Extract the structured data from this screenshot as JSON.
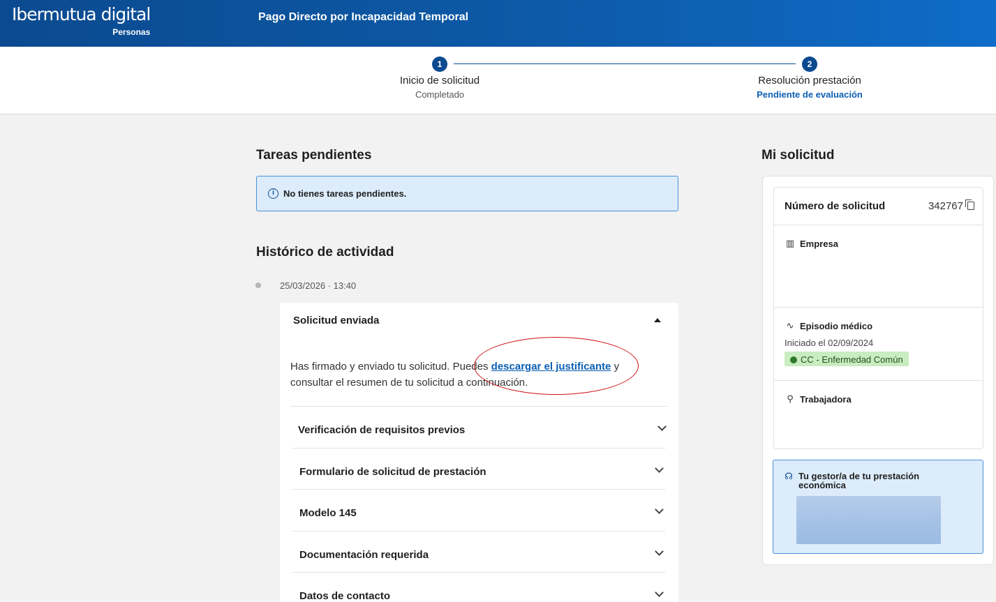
{
  "header": {
    "logo_text": "Ibermutua digital",
    "logo_sub": "Personas",
    "title": "Pago Directo por Incapacidad Temporal"
  },
  "stepper": {
    "steps": [
      {
        "number": "1",
        "title": "Inicio de solicitud",
        "status": "Completado"
      },
      {
        "number": "2",
        "title": "Resolución prestación",
        "status": "Pendiente de evaluación"
      }
    ]
  },
  "tareas": {
    "title": "Tareas pendientes",
    "message": "No tienes tareas pendientes."
  },
  "historico": {
    "title": "Histórico de actividad",
    "date": "25/03/2026 · 13:40",
    "card_title": "Solicitud enviada",
    "text_before": "Has firmado y enviado tu solicitud. Puedes ",
    "link": "descargar el justificante",
    "text_after": " y consultar el resumen de tu solicitud a continuación.",
    "sections": [
      "Verificación de requisitos previos",
      "Formulario de solicitud de prestación",
      "Modelo 145",
      "Documentación requerida",
      "Datos de contacto"
    ]
  },
  "solicitud": {
    "title": "Mi solicitud",
    "numero_label": "Número de solicitud",
    "numero_value": "342767",
    "empresa_label": "Empresa",
    "episodio_label": "Episodio médico",
    "episodio_fecha": "Iniciado el 02/09/2024",
    "episodio_badge": "CC - Enfermedad Común",
    "trabajadora_label": "Trabajadora",
    "gestor_title": "Tu gestor/a de tu prestación económica"
  },
  "icons": {
    "copy": "copy-icon",
    "empresa": "building-icon",
    "episodio": "pulse-icon",
    "trabajadora": "person-icon",
    "gestor": "headset-icon",
    "info": "info-icon"
  },
  "colors": {
    "brand": "#0b4a8f",
    "info_bg": "#dcecfb",
    "badge_bg": "#c9ecc1",
    "annotation": "#d0101a"
  }
}
